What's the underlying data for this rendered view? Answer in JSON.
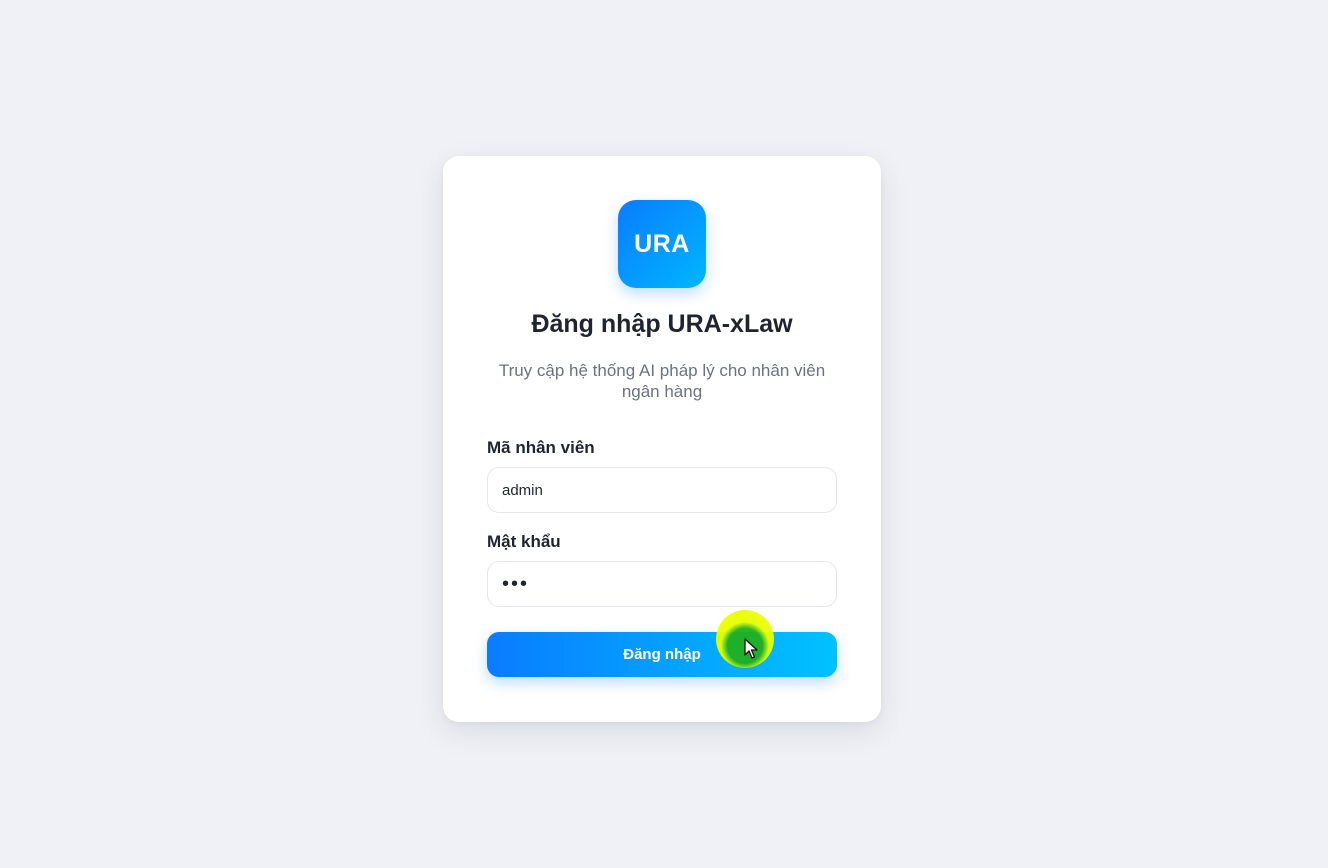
{
  "logo": {
    "text": "URA"
  },
  "title": "Đăng nhập URA-xLaw",
  "subtitle": "Truy cập hệ thống AI pháp lý cho nhân viên ngân hàng",
  "form": {
    "employee_id_label": "Mã nhân viên",
    "employee_id_value": "admin",
    "password_label": "Mật khẩu",
    "password_value": "•••",
    "submit_label": "Đăng nhập"
  },
  "colors": {
    "accent_start": "#0a7cff",
    "accent_end": "#00c2ff",
    "background": "#eff1f6"
  },
  "icons": {
    "cursor": "pointer-cursor-icon"
  }
}
